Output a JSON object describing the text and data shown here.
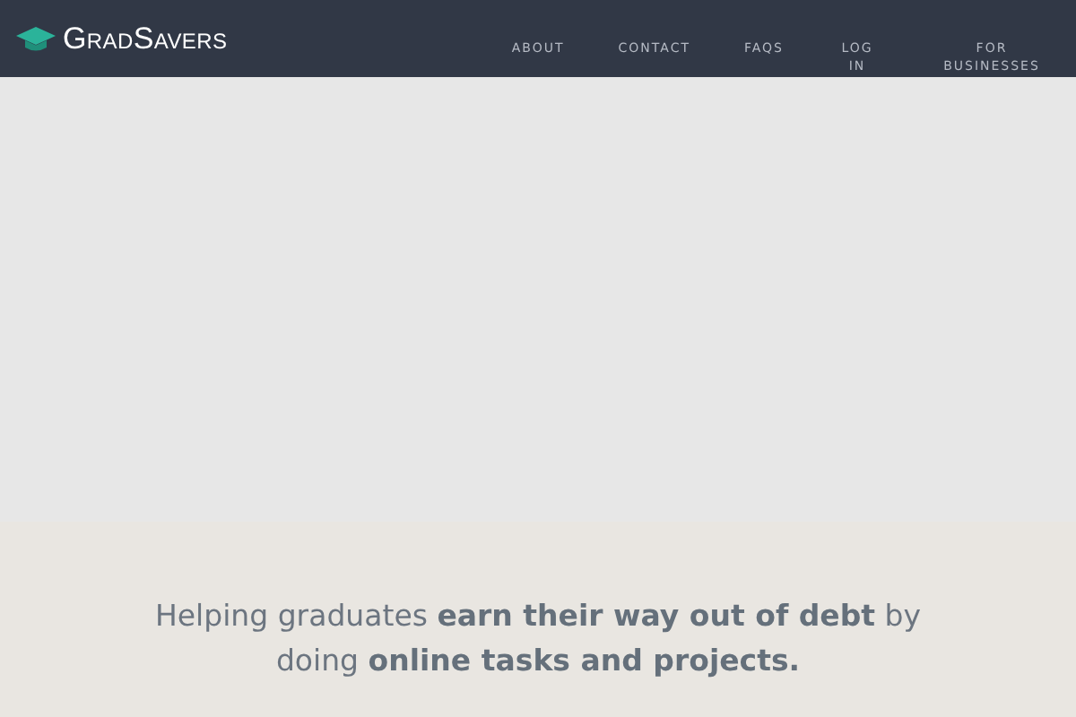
{
  "header": {
    "logo": "GradSavers",
    "nav": [
      {
        "label": "ABOUT"
      },
      {
        "label": "CONTACT"
      },
      {
        "label": "FAQS"
      },
      {
        "label": "LOG IN"
      },
      {
        "label": "FOR BUSINESSES"
      }
    ]
  },
  "tagline": "Helping graduates **earn their way out of debt** by doing **online tasks and projects.**"
}
